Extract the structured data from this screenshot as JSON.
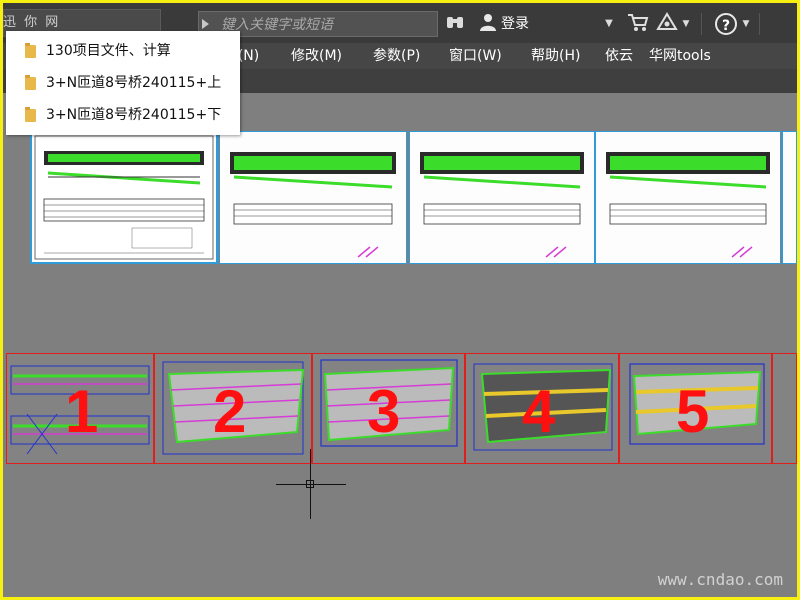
{
  "app": {
    "corner_logo": "迅 你 网",
    "search_placeholder": "键入关键字或短语",
    "login_label": "登录",
    "help_label": "?"
  },
  "menu": {
    "items": [
      "E(N)",
      "修改(M)",
      "参数(P)",
      "窗口(W)",
      "帮助(H)",
      "依云",
      "华网tools"
    ]
  },
  "recent_files": {
    "items": [
      {
        "label": "130项目文件、计算",
        "icon": "folder-icon"
      },
      {
        "label": "3+N匝道8号桥240115+上",
        "icon": "folder-icon"
      },
      {
        "label": "3+N匝道8号桥240115+下",
        "icon": "folder-icon"
      }
    ]
  },
  "layout_thumbnails": {
    "count": 5
  },
  "drawings": {
    "labels": [
      "1",
      "2",
      "3",
      "4",
      "5"
    ]
  },
  "watermark": "www.cndao.com",
  "colors": {
    "outer_frame": "#f6ef12",
    "canvas": "#7f7f7f",
    "layout_border": "#2f9bd8",
    "drawing_border": "#e01e1e",
    "number_color": "#ff1010"
  }
}
